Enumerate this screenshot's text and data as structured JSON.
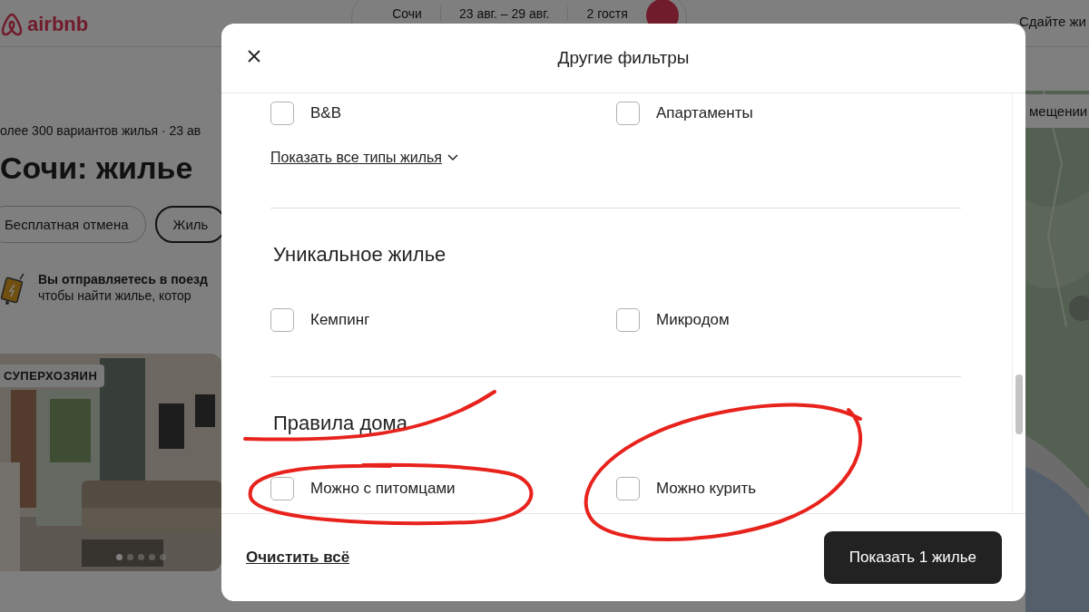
{
  "page": {
    "logo": "airbnb",
    "search": {
      "location": "Сочи",
      "dates": "23 авг. – 29 авг.",
      "guests": "2 гостя"
    },
    "host_link": "Сдайте жи",
    "summary": "олее 300 вариантов жилья · 23 ав",
    "title": "Сочи: жилье",
    "chips": [
      {
        "label": "Бесплатная отмена",
        "selected": false
      },
      {
        "label": "Жиль",
        "selected": true
      }
    ],
    "banner": {
      "title": "Вы отправляетесь в поезд",
      "text": "чтобы найти жилье, котор"
    },
    "listing": {
      "badge": "СУПЕРХОЗЯИН",
      "photo_dots": [
        {
          "selected": true
        },
        {
          "selected": false
        },
        {
          "selected": false
        },
        {
          "selected": false
        },
        {
          "selected": false
        }
      ]
    },
    "map": {
      "toggle": "мещении"
    }
  },
  "modal": {
    "title": "Другие фильтры",
    "sections": [
      {
        "options": [
          {
            "label": "B&B",
            "checked": false
          },
          {
            "label": "Апартаменты",
            "checked": false
          }
        ],
        "link": "Показать все типы жилья"
      },
      {
        "heading": "Уникальное жилье",
        "options": [
          {
            "label": "Кемпинг",
            "checked": false
          },
          {
            "label": "Микродом",
            "checked": false
          }
        ]
      },
      {
        "heading": "Правила дома",
        "options": [
          {
            "label": "Можно с питомцами",
            "checked": false
          },
          {
            "label": "Можно курить",
            "checked": false
          }
        ]
      }
    ],
    "clear": "Очистить всё",
    "submit": "Показать 1 жилье"
  },
  "annotations": [
    {
      "kind": "stroke"
    },
    {
      "kind": "ellipse"
    },
    {
      "kind": "ellipse"
    }
  ]
}
